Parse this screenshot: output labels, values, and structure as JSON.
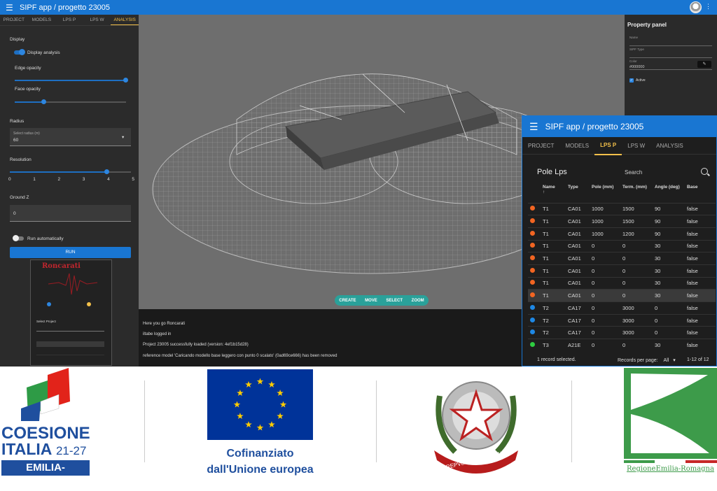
{
  "app": {
    "title": "SIPF app / progetto 23005",
    "tabs_small": [
      "PROJECT",
      "MODELS",
      "LPS P",
      "LPS W",
      "ANALYSIS"
    ],
    "active_tab_small": "ANALYSIS"
  },
  "left_panel": {
    "display_label": "Display",
    "display_analysis_label": "Display analysis",
    "display_analysis_on": true,
    "edge_opacity_label": "Edge opacity",
    "face_opacity_label": "Face opacity",
    "radius_label": "Radius",
    "radius_select_label": "Select radius (m)",
    "radius_value": "60",
    "resolution_label": "Resolution",
    "resolution_ticks": [
      "0",
      "1",
      "2",
      "3",
      "4",
      "5"
    ],
    "resolution_value": 4,
    "ground_z_label": "Ground Z",
    "ground_z_value": "0",
    "run_auto_label": "Run automatically",
    "run_auto_on": false,
    "run_button": "RUN",
    "thumb_brand": "Roncarati",
    "thumb_select_project": "Select Project"
  },
  "viewport_toolbar": [
    "CREATE",
    "MOVE",
    "SELECT",
    "ZOOM"
  ],
  "console": {
    "lines": [
      "Here you go Roncarati",
      "iltabe logged in",
      "Project 23005 successfully loaded (version: 4ef1b15d28)",
      "reference model 'Caricando modello base leggero con punto 0 scalato' (0ad69ce666) has been removed"
    ]
  },
  "property_panel": {
    "title": "Property panel",
    "name_label": "Name",
    "type_label": "SIPF Type",
    "color_label": "Color",
    "color_value": "#000000",
    "active_label": "Active"
  },
  "lps_window": {
    "title": "SIPF app / progetto 23005",
    "tabs": [
      "PROJECT",
      "MODELS",
      "LPS P",
      "LPS W",
      "ANALYSIS"
    ],
    "active_tab": "LPS P",
    "heading": "Pole Lps",
    "search_placeholder": "Search",
    "columns": [
      "Name",
      "Type",
      "Pole (mm)",
      "Term. (mm)",
      "Angle (deg)",
      "Base"
    ],
    "rows": [
      {
        "color": "#f26522",
        "name": "T1",
        "type": "CA01",
        "pole": "1000",
        "term": "1500",
        "angle": "90",
        "base": "false"
      },
      {
        "color": "#f26522",
        "name": "T1",
        "type": "CA01",
        "pole": "1000",
        "term": "1500",
        "angle": "90",
        "base": "false"
      },
      {
        "color": "#f26522",
        "name": "T1",
        "type": "CA01",
        "pole": "1000",
        "term": "1200",
        "angle": "90",
        "base": "false"
      },
      {
        "color": "#f26522",
        "name": "T1",
        "type": "CA01",
        "pole": "0",
        "term": "0",
        "angle": "30",
        "base": "false"
      },
      {
        "color": "#f26522",
        "name": "T1",
        "type": "CA01",
        "pole": "0",
        "term": "0",
        "angle": "30",
        "base": "false"
      },
      {
        "color": "#f26522",
        "name": "T1",
        "type": "CA01",
        "pole": "0",
        "term": "0",
        "angle": "30",
        "base": "false"
      },
      {
        "color": "#f26522",
        "name": "T1",
        "type": "CA01",
        "pole": "0",
        "term": "0",
        "angle": "30",
        "base": "false"
      },
      {
        "color": "#f26522",
        "name": "T1",
        "type": "CA01",
        "pole": "0",
        "term": "0",
        "angle": "30",
        "base": "false",
        "selected": true
      },
      {
        "color": "#1e88e5",
        "name": "T2",
        "type": "CA17",
        "pole": "0",
        "term": "3000",
        "angle": "0",
        "base": "false"
      },
      {
        "color": "#1e88e5",
        "name": "T2",
        "type": "CA17",
        "pole": "0",
        "term": "3000",
        "angle": "0",
        "base": "false"
      },
      {
        "color": "#1e88e5",
        "name": "T2",
        "type": "CA17",
        "pole": "0",
        "term": "3000",
        "angle": "0",
        "base": "false"
      },
      {
        "color": "#2ecc40",
        "name": "T3",
        "type": "A21E",
        "pole": "0",
        "term": "0",
        "angle": "30",
        "base": "false"
      }
    ],
    "footer_selected": "1 record selected.",
    "records_per_page_label": "Records per page:",
    "records_per_page_value": "All",
    "range": "1-12 of 12"
  },
  "logos": {
    "coesione_line1": "COESIONE",
    "coesione_line2": "ITALIA",
    "coesione_years": "21-27",
    "coesione_region": "EMILIA-ROMAGNA",
    "eu_line1": "Cofinanziato",
    "eu_line2": "dall'Unione europea",
    "repubblica_text": "REPVBBLICA ITALIANA",
    "regione_text": "RegioneEmilia-Romagna"
  },
  "colors": {
    "primary": "#1976d2",
    "accent_tab": "#f3c04a",
    "toolbar": "#2aa19a",
    "eu_blue": "#003399",
    "eu_gold": "#ffcc00",
    "coesione_red": "#e2231a",
    "coesione_green": "#2e9b46",
    "coesione_blue": "#1f4f9e",
    "regione_green": "#3d9b4a"
  }
}
